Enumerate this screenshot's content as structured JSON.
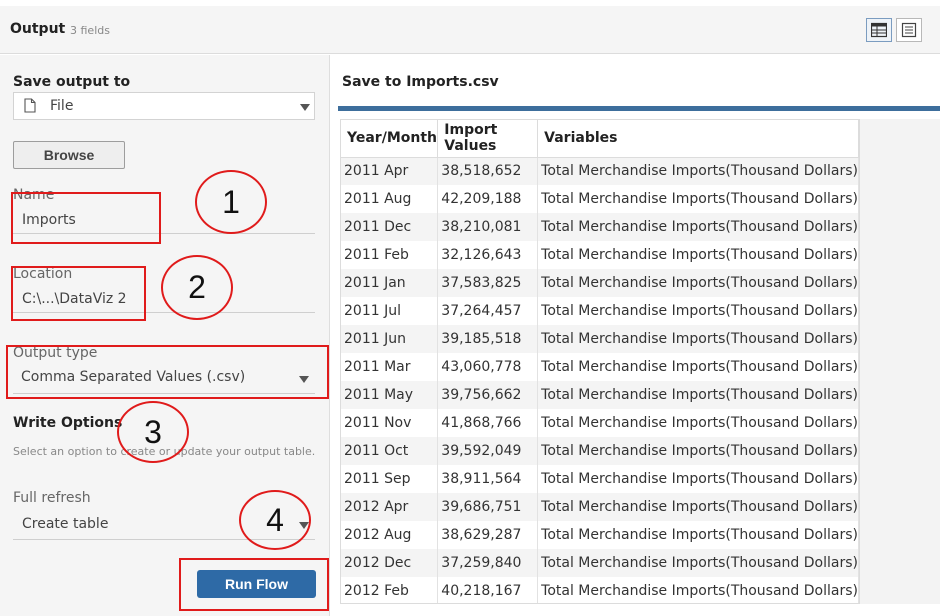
{
  "header": {
    "title": "Output",
    "field_count": "3 fields"
  },
  "save_output": {
    "label": "Save output to",
    "selected": "File",
    "browse_label": "Browse"
  },
  "name": {
    "label": "Name",
    "value": "Imports"
  },
  "location": {
    "label": "Location",
    "value": "C:\\...\\DataViz 2"
  },
  "output_type": {
    "label": "Output type",
    "value": "Comma Separated Values (.csv)"
  },
  "write_options": {
    "label": "Write Options",
    "help": "Select an option to create or update your output table.",
    "mode_label": "Full refresh",
    "mode_value": "Create table"
  },
  "run_flow_label": "Run Flow",
  "annotations": [
    "1",
    "2",
    "3",
    "4"
  ],
  "annotation_color": "#e01b1b",
  "preview": {
    "title": "Save to Imports.csv",
    "columns": [
      "Year/Month",
      "Import Values",
      "Variables"
    ],
    "rows": [
      [
        "2011 Apr",
        "38,518,652",
        "Total Merchandise Imports(Thousand Dollars)"
      ],
      [
        "2011 Aug",
        "42,209,188",
        "Total Merchandise Imports(Thousand Dollars)"
      ],
      [
        "2011 Dec",
        "38,210,081",
        "Total Merchandise Imports(Thousand Dollars)"
      ],
      [
        "2011 Feb",
        "32,126,643",
        "Total Merchandise Imports(Thousand Dollars)"
      ],
      [
        "2011 Jan",
        "37,583,825",
        "Total Merchandise Imports(Thousand Dollars)"
      ],
      [
        "2011 Jul",
        "37,264,457",
        "Total Merchandise Imports(Thousand Dollars)"
      ],
      [
        "2011 Jun",
        "39,185,518",
        "Total Merchandise Imports(Thousand Dollars)"
      ],
      [
        "2011 Mar",
        "43,060,778",
        "Total Merchandise Imports(Thousand Dollars)"
      ],
      [
        "2011 May",
        "39,756,662",
        "Total Merchandise Imports(Thousand Dollars)"
      ],
      [
        "2011 Nov",
        "41,868,766",
        "Total Merchandise Imports(Thousand Dollars)"
      ],
      [
        "2011 Oct",
        "39,592,049",
        "Total Merchandise Imports(Thousand Dollars)"
      ],
      [
        "2011 Sep",
        "38,911,564",
        "Total Merchandise Imports(Thousand Dollars)"
      ],
      [
        "2012 Apr",
        "39,686,751",
        "Total Merchandise Imports(Thousand Dollars)"
      ],
      [
        "2012 Aug",
        "38,629,287",
        "Total Merchandise Imports(Thousand Dollars)"
      ],
      [
        "2012 Dec",
        "37,259,840",
        "Total Merchandise Imports(Thousand Dollars)"
      ],
      [
        "2012 Feb",
        "40,218,167",
        "Total Merchandise Imports(Thousand Dollars)"
      ]
    ]
  },
  "icons": {
    "table_view": "table-grid-icon",
    "list_view": "list-view-icon",
    "file": "file-icon",
    "dropdown": "chevron-down-icon"
  },
  "accent_color": "#2e6aa6"
}
